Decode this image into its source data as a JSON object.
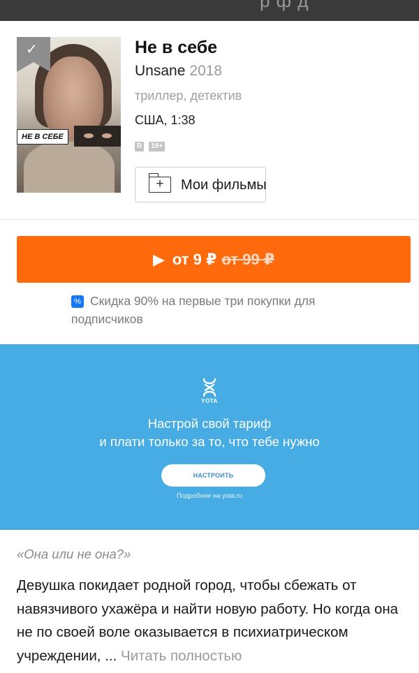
{
  "topbar": {
    "partial_title": "р ф   д"
  },
  "movie": {
    "poster_text": "НЕ В СЕБЕ",
    "title": "Не в себе",
    "original_title": "Unsane",
    "year": "2018",
    "genres": "триллер, детектив",
    "country_duration": "США, 1:38",
    "badges": [
      "R",
      "18+"
    ],
    "my_films_label": "Мои фильмы"
  },
  "purchase": {
    "price_label": "от 9 ₽",
    "old_price_label": "от 99 ₽",
    "accent_color": "#ff6a0d"
  },
  "discount": {
    "icon": "%",
    "text": "Скидка 90% на первые три покупки для подписчиков"
  },
  "ad": {
    "brand": "YOTA",
    "line1": "Настрой свой тариф",
    "line2": "и плати только за то, что тебе нужно",
    "button": "НАСТРОИТЬ",
    "more": "Подробнее на yota.ru",
    "background": "#46ace3"
  },
  "description": {
    "tagline": "«Она или не она?»",
    "text": "Девушка покидает родной город, чтобы сбежать от навязчивого ухажёра и найти новую работу. Но когда она не по своей воле оказывается в психиатрическом учреждении, ...",
    "read_more": "Читать полностью"
  }
}
